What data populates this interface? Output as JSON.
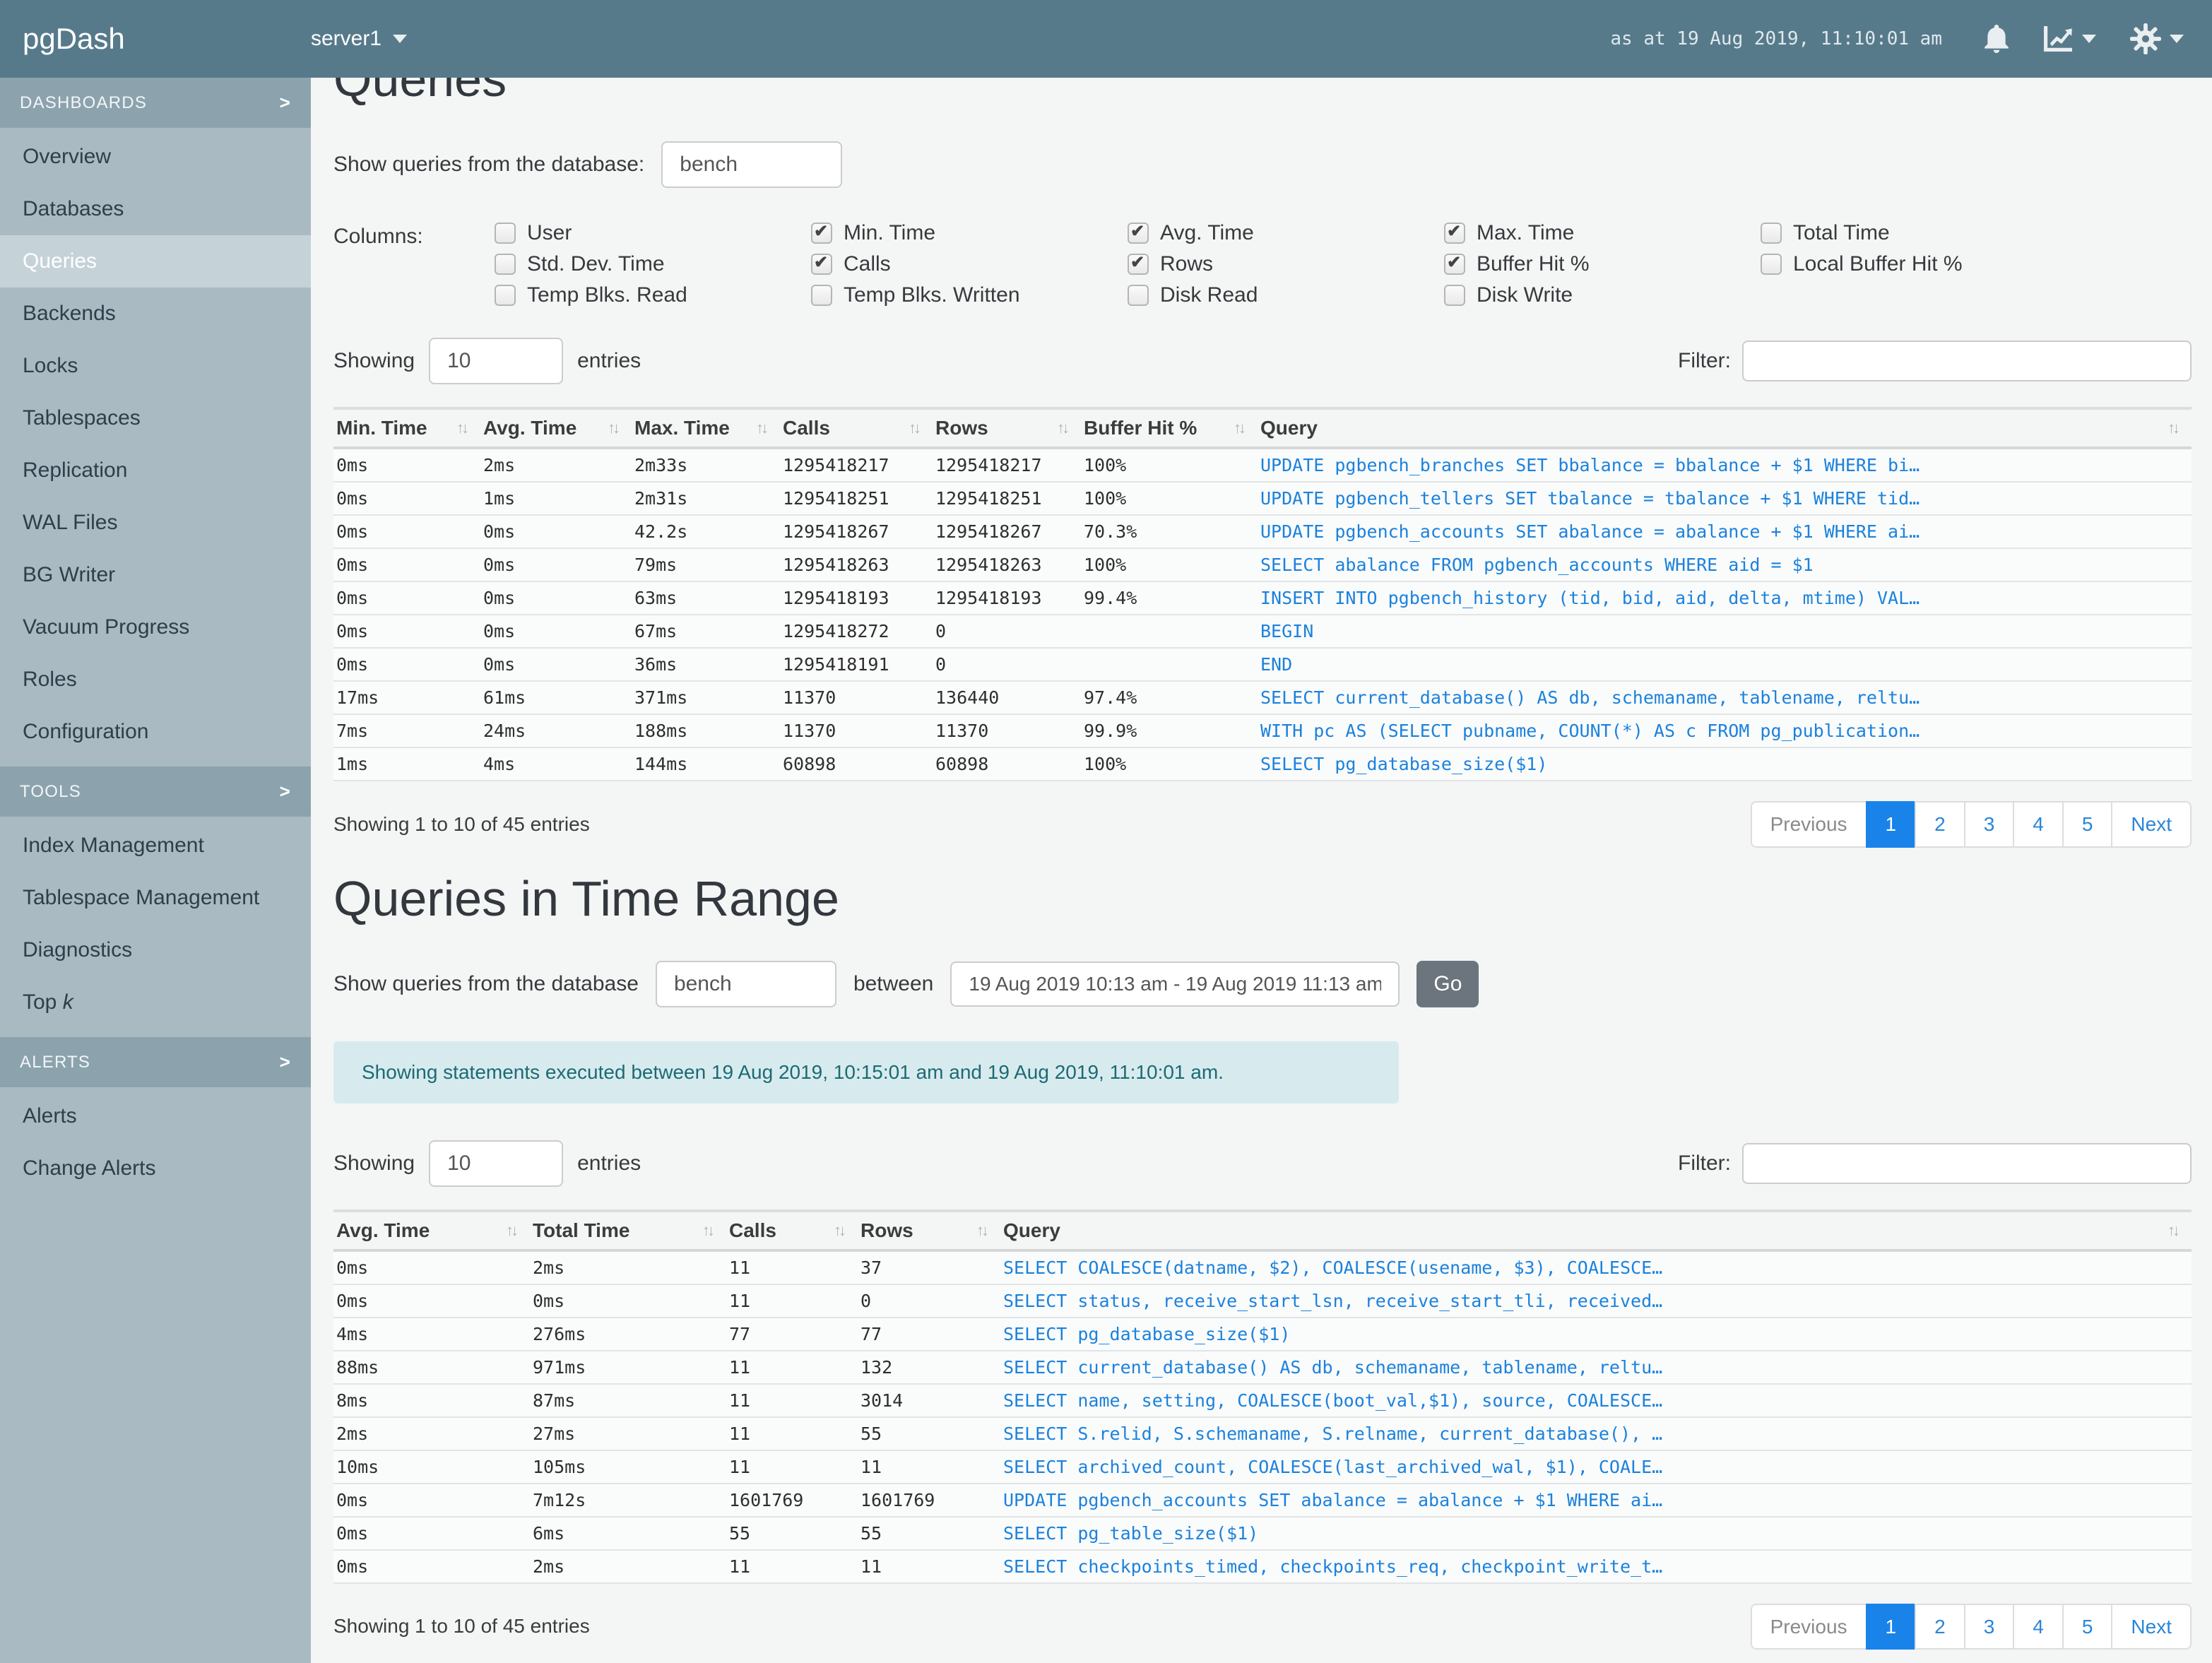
{
  "colors": {
    "topbar": "#577a8b",
    "sidebar": "#a9bac2",
    "sidebar_section": "#8ca3ae",
    "accent_blue": "#1b82dd",
    "pagination_active": "#1a83ea",
    "alert_bg": "#d7ebee",
    "alert_text": "#1d6a74"
  },
  "header": {
    "brand": "pgDash",
    "server": "server1",
    "timestamp": "as at 19 Aug 2019, 11:10:01 am"
  },
  "sidebar": {
    "sections": [
      {
        "label": "DASHBOARDS",
        "items": [
          {
            "label": "Overview"
          },
          {
            "label": "Databases"
          },
          {
            "label": "Queries",
            "active": true
          },
          {
            "label": "Backends"
          },
          {
            "label": "Locks"
          },
          {
            "label": "Tablespaces"
          },
          {
            "label": "Replication"
          },
          {
            "label": "WAL Files"
          },
          {
            "label": "BG Writer"
          },
          {
            "label": "Vacuum Progress"
          },
          {
            "label": "Roles"
          },
          {
            "label": "Configuration"
          }
        ]
      },
      {
        "label": "TOOLS",
        "items": [
          {
            "label": "Index Management"
          },
          {
            "label": "Tablespace Management"
          },
          {
            "label": "Diagnostics"
          },
          {
            "label": "Top",
            "italic": "k"
          }
        ]
      },
      {
        "label": "ALERTS",
        "items": [
          {
            "label": "Alerts"
          },
          {
            "label": "Change Alerts"
          }
        ]
      }
    ]
  },
  "queries": {
    "title": "Queries",
    "db_label": "Show queries from the database:",
    "db_value": "bench",
    "columns_label": "Columns:",
    "column_groups": [
      [
        {
          "label": "User",
          "checked": false
        },
        {
          "label": "Std. Dev. Time",
          "checked": false
        },
        {
          "label": "Temp Blks. Read",
          "checked": false
        }
      ],
      [
        {
          "label": "Min. Time",
          "checked": true
        },
        {
          "label": "Calls",
          "checked": true
        },
        {
          "label": "Temp Blks. Written",
          "checked": false
        }
      ],
      [
        {
          "label": "Avg. Time",
          "checked": true
        },
        {
          "label": "Rows",
          "checked": true
        },
        {
          "label": "Disk Read",
          "checked": false
        }
      ],
      [
        {
          "label": "Max. Time",
          "checked": true
        },
        {
          "label": "Buffer Hit %",
          "checked": true
        },
        {
          "label": "Disk Write",
          "checked": false
        }
      ],
      [
        {
          "label": "Total Time",
          "checked": false
        },
        {
          "label": "Local Buffer Hit %",
          "checked": false
        }
      ]
    ],
    "showing_label": "Showing",
    "entries_value": "10",
    "entries_label": "entries",
    "filter_label": "Filter:",
    "filter_value": "",
    "table": {
      "headers": [
        "Min. Time",
        "Avg. Time",
        "Max. Time",
        "Calls",
        "Rows",
        "Buffer Hit %",
        "Query"
      ],
      "rows": [
        [
          "0ms",
          "2ms",
          "2m33s",
          "1295418217",
          "1295418217",
          "100%",
          "UPDATE pgbench_branches SET bbalance = bbalance + $1 WHERE bi…"
        ],
        [
          "0ms",
          "1ms",
          "2m31s",
          "1295418251",
          "1295418251",
          "100%",
          "UPDATE pgbench_tellers SET tbalance = tbalance + $1 WHERE tid…"
        ],
        [
          "0ms",
          "0ms",
          "42.2s",
          "1295418267",
          "1295418267",
          "70.3%",
          "UPDATE pgbench_accounts SET abalance = abalance + $1 WHERE ai…"
        ],
        [
          "0ms",
          "0ms",
          "79ms",
          "1295418263",
          "1295418263",
          "100%",
          "SELECT abalance FROM pgbench_accounts WHERE aid = $1"
        ],
        [
          "0ms",
          "0ms",
          "63ms",
          "1295418193",
          "1295418193",
          "99.4%",
          "INSERT INTO pgbench_history (tid, bid, aid, delta, mtime) VAL…"
        ],
        [
          "0ms",
          "0ms",
          "67ms",
          "1295418272",
          "0",
          "",
          "BEGIN"
        ],
        [
          "0ms",
          "0ms",
          "36ms",
          "1295418191",
          "0",
          "",
          "END"
        ],
        [
          "17ms",
          "61ms",
          "371ms",
          "11370",
          "136440",
          "97.4%",
          "SELECT current_database() AS db, schemaname, tablename, reltu…"
        ],
        [
          "7ms",
          "24ms",
          "188ms",
          "11370",
          "11370",
          "99.9%",
          "WITH pc AS (SELECT pubname, COUNT(*) AS c FROM pg_publication…"
        ],
        [
          "1ms",
          "4ms",
          "144ms",
          "60898",
          "60898",
          "100%",
          "SELECT pg_database_size($1)"
        ]
      ]
    },
    "status": "Showing 1 to 10 of 45 entries",
    "pagination": {
      "prev": "Previous",
      "pages": [
        "1",
        "2",
        "3",
        "4",
        "5"
      ],
      "active": "1",
      "next": "Next"
    }
  },
  "time_range": {
    "title": "Queries in Time Range",
    "db_label": "Show queries from the database",
    "db_value": "bench",
    "between_label": "between",
    "range_value": "19 Aug 2019 10:13 am - 19 Aug 2019 11:13 am",
    "go_label": "Go",
    "alert": "Showing statements executed between 19 Aug 2019, 10:15:01 am and 19 Aug 2019, 11:10:01 am.",
    "showing_label": "Showing",
    "entries_value": "10",
    "entries_label": "entries",
    "filter_label": "Filter:",
    "filter_value": "",
    "table": {
      "headers": [
        "Avg. Time",
        "Total Time",
        "Calls",
        "Rows",
        "Query"
      ],
      "rows": [
        [
          "0ms",
          "2ms",
          "11",
          "37",
          "SELECT COALESCE(datname, $2), COALESCE(usename, $3), COALESCE…"
        ],
        [
          "0ms",
          "0ms",
          "11",
          "0",
          "SELECT status, receive_start_lsn, receive_start_tli, received…"
        ],
        [
          "4ms",
          "276ms",
          "77",
          "77",
          "SELECT pg_database_size($1)"
        ],
        [
          "88ms",
          "971ms",
          "11",
          "132",
          "SELECT current_database() AS db, schemaname, tablename, reltu…"
        ],
        [
          "8ms",
          "87ms",
          "11",
          "3014",
          "SELECT name, setting, COALESCE(boot_val,$1), source, COALESCE…"
        ],
        [
          "2ms",
          "27ms",
          "11",
          "55",
          "SELECT S.relid, S.schemaname, S.relname, current_database(), …"
        ],
        [
          "10ms",
          "105ms",
          "11",
          "11",
          "SELECT archived_count, COALESCE(last_archived_wal, $1), COALE…"
        ],
        [
          "0ms",
          "7m12s",
          "1601769",
          "1601769",
          "UPDATE pgbench_accounts SET abalance = abalance + $1 WHERE ai…"
        ],
        [
          "0ms",
          "6ms",
          "55",
          "55",
          "SELECT pg_table_size($1)"
        ],
        [
          "0ms",
          "2ms",
          "11",
          "11",
          "SELECT checkpoints_timed, checkpoints_req, checkpoint_write_t…"
        ]
      ]
    },
    "status": "Showing 1 to 10 of 45 entries",
    "pagination": {
      "prev": "Previous",
      "pages": [
        "1",
        "2",
        "3",
        "4",
        "5"
      ],
      "active": "1",
      "next": "Next"
    }
  }
}
